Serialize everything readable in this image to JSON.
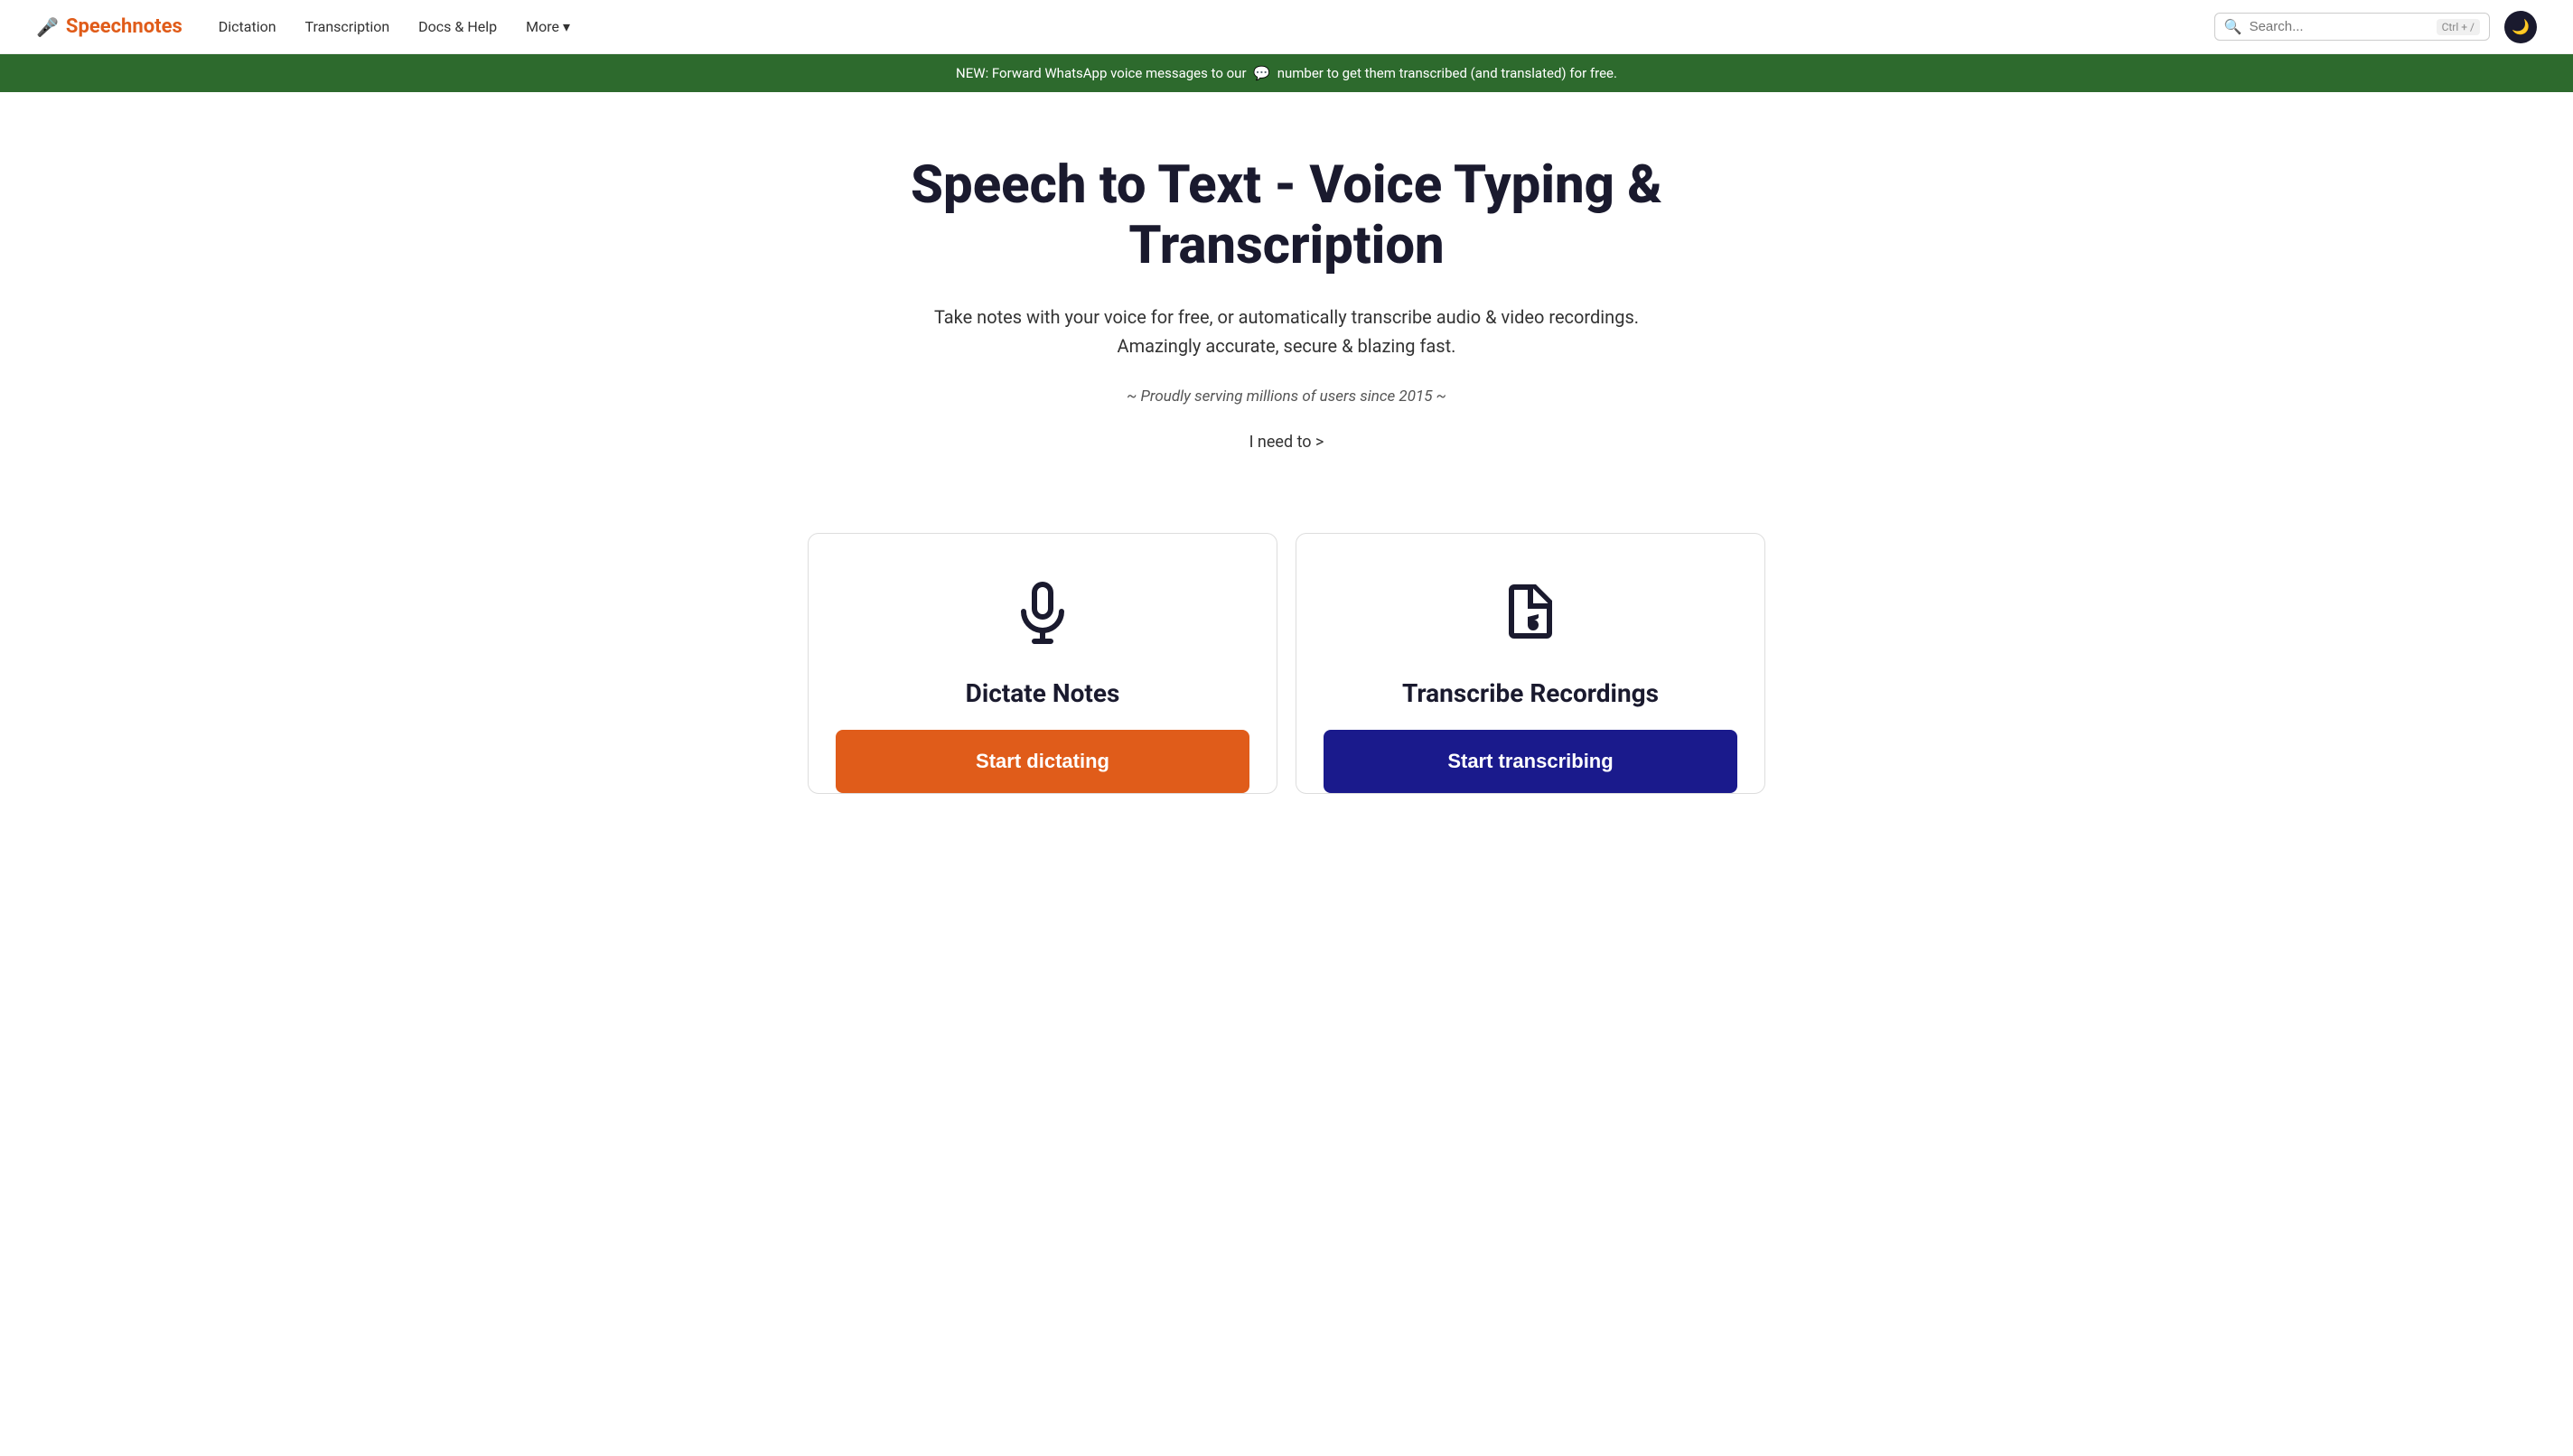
{
  "brand": {
    "icon": "🎤",
    "name": "Speechnotes",
    "url": "#"
  },
  "nav": {
    "links": [
      {
        "label": "Dictation",
        "id": "dictation"
      },
      {
        "label": "Transcription",
        "id": "transcription"
      },
      {
        "label": "Docs & Help",
        "id": "docs-help"
      },
      {
        "label": "More",
        "id": "more"
      }
    ]
  },
  "search": {
    "placeholder": "Search...",
    "shortcut": "Ctrl + /"
  },
  "banner": {
    "text_before": "NEW: Forward WhatsApp voice messages to our",
    "text_after": "number to get them transcribed (and translated) for free."
  },
  "hero": {
    "title": "Speech to Text - Voice Typing & Transcription",
    "subtitle": "Take notes with your voice for free, or automatically transcribe audio & video recordings.\nAmazingly accurate, secure & blazing fast.",
    "tagline": "~ Proudly serving millions of users since 2015 ~",
    "cta": "I need to >"
  },
  "cards": [
    {
      "id": "dictate",
      "title": "Dictate Notes",
      "button_label": "Start dictating",
      "button_type": "dictate"
    },
    {
      "id": "transcribe",
      "title": "Transcribe Recordings",
      "button_label": "Start transcribing",
      "button_type": "transcribe"
    }
  ]
}
